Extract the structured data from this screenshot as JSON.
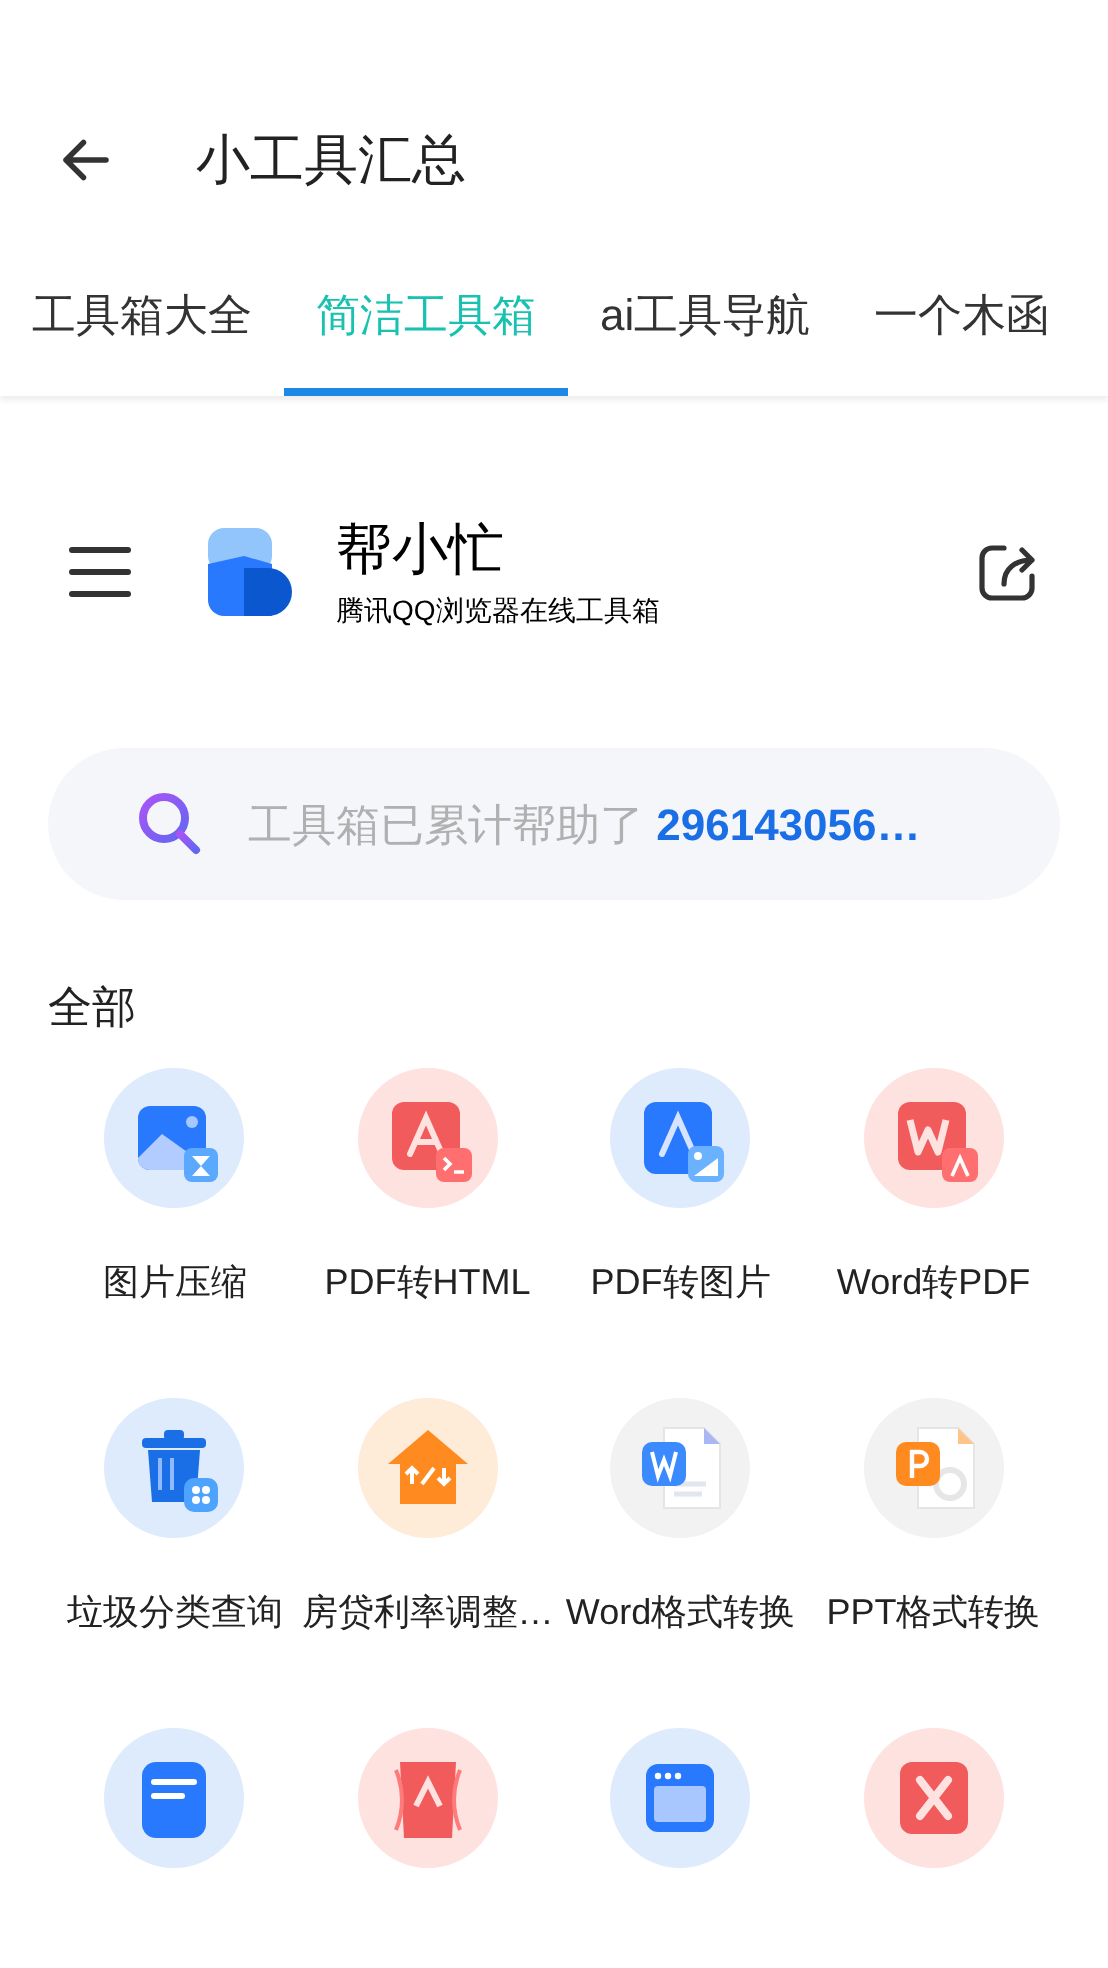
{
  "header": {
    "title": "小工具汇总"
  },
  "tabs": [
    {
      "label": "工具箱大全",
      "selected": false
    },
    {
      "label": "简洁工具箱",
      "selected": true
    },
    {
      "label": "ai工具导航",
      "selected": false
    },
    {
      "label": "一个木函",
      "selected": false
    }
  ],
  "app_bar": {
    "name": "帮小忙",
    "subtitle": "腾讯QQ浏览器在线工具箱"
  },
  "search": {
    "text": "工具箱已累计帮助了 **296143056…**"
  },
  "section": {
    "title": "全部"
  },
  "tools": [
    {
      "kind": "image-compress",
      "label": "图片压缩"
    },
    {
      "kind": "pdf-html",
      "label": "PDF转HTML"
    },
    {
      "kind": "pdf-image",
      "label": "PDF转图片"
    },
    {
      "kind": "word-pdf",
      "label": "Word转PDF"
    },
    {
      "kind": "trash",
      "label": "垃圾分类查询"
    },
    {
      "kind": "house-rate",
      "label": "房贷利率调整…"
    },
    {
      "kind": "word-doc",
      "label": "Word格式转换"
    },
    {
      "kind": "ppt-doc",
      "label": "PPT格式转换"
    },
    {
      "kind": "text-doc"
    },
    {
      "kind": "pdf-red"
    },
    {
      "kind": "browser"
    },
    {
      "kind": "excel"
    }
  ]
}
